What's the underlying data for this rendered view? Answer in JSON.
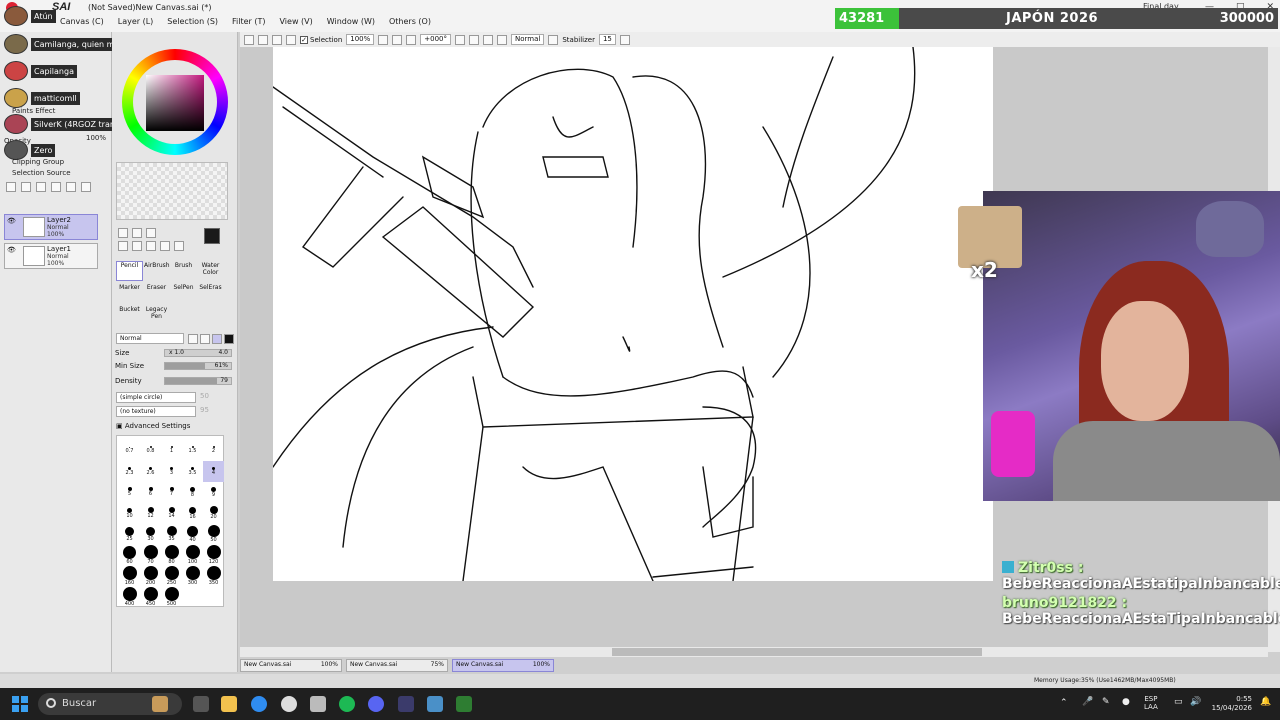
{
  "app": {
    "logo": "SAI",
    "window_title": "(Not Saved)New Canvas.sai (*)",
    "menu": [
      "Canvas (C)",
      "Layer (L)",
      "Selection (S)",
      "Filter (T)",
      "View (V)",
      "Window (W)",
      "Others (O)"
    ],
    "window_caption": "Final day"
  },
  "goal": {
    "current": "43281",
    "title": "JAPÓN 2026",
    "target": "300000",
    "progress": 0.144
  },
  "toolbar": {
    "selection_label": "Selection",
    "zoom": "100%",
    "rotation": "+000°",
    "blend": "Normal",
    "stabilizer_label": "Stabilizer",
    "stabilizer_value": "15"
  },
  "chat_users": [
    {
      "name": "Atún"
    },
    {
      "name": "Camilanga, quien más"
    },
    {
      "name": "Capilanga"
    },
    {
      "name": "matticomll"
    },
    {
      "name": "SilverK (4RGOZ tranquilo)"
    },
    {
      "name": "Zero"
    }
  ],
  "layer_panel": {
    "effect_label": "Paints Effect",
    "opacity_label": "Opacity",
    "opacity_value": "100%",
    "clipping_group": "Clipping Group",
    "selection_source": "Selection Source",
    "layers": [
      {
        "name": "Layer2",
        "mode": "Normal",
        "opacity": "100%",
        "active": true
      },
      {
        "name": "Layer1",
        "mode": "Normal",
        "opacity": "100%",
        "active": false
      }
    ]
  },
  "tool_panel": {
    "primary_color": "#1a1a1a",
    "brushes": [
      {
        "label": "Pencil",
        "active": true
      },
      {
        "label": "AirBrush",
        "active": false
      },
      {
        "label": "Brush",
        "active": false
      },
      {
        "label": "Water Color",
        "active": false
      },
      {
        "label": "Marker",
        "active": false
      },
      {
        "label": "Eraser",
        "active": false
      },
      {
        "label": "SelPen",
        "active": false
      },
      {
        "label": "SelEras",
        "active": false
      },
      {
        "label": "Bucket",
        "active": false
      },
      {
        "label": "Legacy Pen",
        "active": false
      }
    ],
    "blend_mode": "Normal",
    "size_label": "Size",
    "size_mult": "x 1.0",
    "size_value": "4.0",
    "min_size_label": "Min Size",
    "min_size_value": "61%",
    "min_size_fill": 0.61,
    "density_label": "Density",
    "density_value": "79",
    "density_fill": 0.79,
    "shape": "(simple circle)",
    "shape_value": "50",
    "texture": "(no texture)",
    "texture_value": "95",
    "advanced": "Advanced Settings",
    "sizes": [
      "0.7",
      "0.8",
      "1",
      "1.5",
      "2",
      "2.3",
      "2.6",
      "3",
      "3.5",
      "4",
      "5",
      "6",
      "7",
      "8",
      "9",
      "10",
      "12",
      "14",
      "16",
      "20",
      "25",
      "30",
      "35",
      "40",
      "50",
      "60",
      "70",
      "80",
      "100",
      "120",
      "160",
      "200",
      "250",
      "300",
      "350",
      "400",
      "450",
      "500"
    ]
  },
  "tabs": [
    {
      "name": "New Canvas.sai",
      "zoom": "100%",
      "active": false
    },
    {
      "name": "New Canvas.sai",
      "zoom": "75%",
      "active": false
    },
    {
      "name": "New Canvas.sai",
      "zoom": "100%",
      "active": true
    }
  ],
  "status": {
    "memory": "Memory Usage:35% (Use1462MB/Max4095MB)"
  },
  "stream": {
    "emote_multiplier": "x2",
    "chat": [
      {
        "name": "Zitr0ss :",
        "text": "BebeReaccionaAEstatipaInbancable"
      },
      {
        "name": "bruno9121822 :",
        "text": "BebeReaccionaAEstaTipaInbancable"
      }
    ]
  },
  "taskbar": {
    "search_placeholder": "Buscar",
    "lang_top": "ESP",
    "lang_bottom": "LAA",
    "time": "0:55",
    "date": "15/04/2026"
  }
}
